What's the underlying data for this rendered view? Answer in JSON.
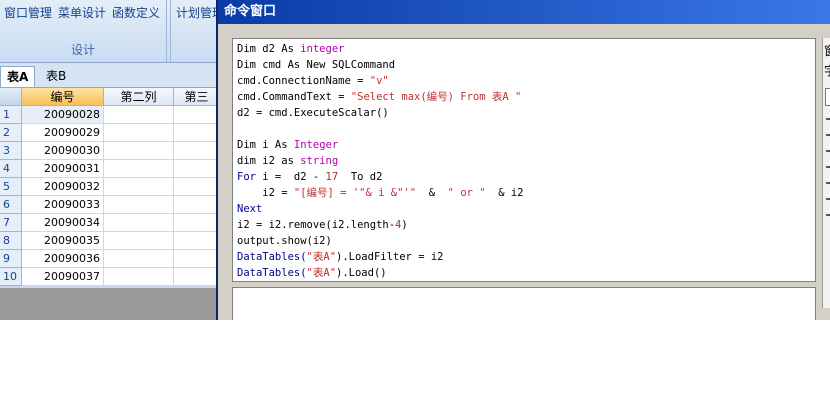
{
  "ribbon": {
    "menu_items": [
      "窗口管理",
      "菜单设计",
      "函数定义"
    ],
    "group_label": "设计",
    "second_group_item": "计划管理"
  },
  "sheet_tabs": [
    {
      "label": "表A",
      "active": true
    },
    {
      "label": "表B",
      "active": false
    }
  ],
  "grid": {
    "columns": [
      "编号",
      "第二列",
      "第三"
    ],
    "rows": [
      {
        "num": "1",
        "id": "20090028"
      },
      {
        "num": "2",
        "id": "20090029"
      },
      {
        "num": "3",
        "id": "20090030"
      },
      {
        "num": "4",
        "id": "20090031"
      },
      {
        "num": "5",
        "id": "20090032"
      },
      {
        "num": "6",
        "id": "20090033"
      },
      {
        "num": "7",
        "id": "20090034"
      },
      {
        "num": "8",
        "id": "20090035"
      },
      {
        "num": "9",
        "id": "20090036"
      },
      {
        "num": "10",
        "id": "20090037"
      }
    ]
  },
  "command_window": {
    "title": "命令窗口",
    "code": {
      "l1": [
        "Dim d2 As ",
        "integer"
      ],
      "l2": "Dim cmd As New SQLCommand",
      "l3": [
        "cmd.ConnectionName = ",
        "\"v\""
      ],
      "l4": [
        "cmd.CommandText = ",
        "\"Select max(编号) From 表A \""
      ],
      "l5": "d2 = cmd.ExecuteScalar()",
      "l6": [
        "Dim i As ",
        "Integer"
      ],
      "l7": [
        "dim i2 as ",
        "string"
      ],
      "l8": [
        "For",
        " i =  d2 - ",
        "17",
        "  To d2"
      ],
      "l9": [
        "    i2 = ",
        "\"[编号] = '\"& i &\"'\"",
        "  &  ",
        "\" or \"",
        "  & i2"
      ],
      "l10": "Next",
      "l11": [
        "i2 = i2.remove(i2.length-",
        "4",
        ")"
      ],
      "l12": "output.show(i2)",
      "l13": [
        "DataTables(",
        "\"表A\"",
        ").LoadFilter = i2"
      ],
      "l14": [
        "DataTables(",
        "\"表A\"",
        ").Load()"
      ]
    },
    "side_labels": [
      "窗",
      "字"
    ]
  },
  "colors": {
    "title_bar": "#0a3aa8",
    "keyword": "#00008b",
    "type": "#b000b0",
    "string": "#c03030",
    "header_selected": "#f8c056"
  }
}
